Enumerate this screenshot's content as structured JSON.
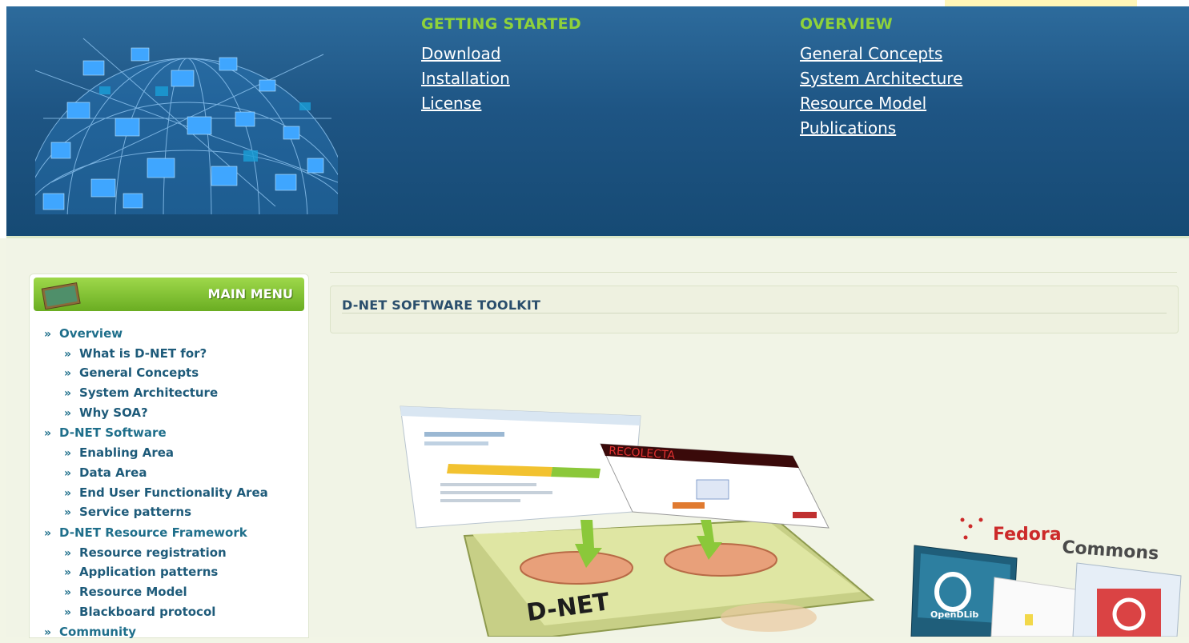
{
  "header": {
    "getting_started": {
      "heading": "GETTING STARTED",
      "links": [
        "Download",
        "Installation",
        "License"
      ]
    },
    "overview": {
      "heading": "OVERVIEW",
      "links": [
        "General Concepts",
        "System Architecture",
        "Resource Model",
        "Publications"
      ]
    }
  },
  "main_menu": {
    "title": "MAIN MENU",
    "items": [
      {
        "label": "Overview",
        "level": 0
      },
      {
        "label": "What is D-NET for?",
        "level": 1
      },
      {
        "label": "General Concepts",
        "level": 1
      },
      {
        "label": "System Architecture",
        "level": 1
      },
      {
        "label": "Why SOA?",
        "level": 1
      },
      {
        "label": "D-NET Software",
        "level": 0
      },
      {
        "label": "Enabling Area",
        "level": 1
      },
      {
        "label": "Data Area",
        "level": 1
      },
      {
        "label": "End User Functionality Area",
        "level": 1
      },
      {
        "label": "Service patterns",
        "level": 1
      },
      {
        "label": "D-NET Resource Framework",
        "level": 0
      },
      {
        "label": "Resource registration",
        "level": 1
      },
      {
        "label": "Application patterns",
        "level": 1
      },
      {
        "label": "Resource Model",
        "level": 1
      },
      {
        "label": "Blackboard protocol",
        "level": 1
      },
      {
        "label": "Community",
        "level": 0
      }
    ],
    "bullet": "»"
  },
  "content": {
    "section_title": "D-NET SOFTWARE TOOLKIT",
    "illustration": {
      "platform_label": "D-NET",
      "screen_label": "RECOLECTA",
      "fedora_label_a": "Fedora",
      "fedora_label_b": "Commons",
      "opendlib_label": "OpenDLib"
    }
  },
  "colors": {
    "header_bg": "#1e5584",
    "nav_heading": "#8fd23a",
    "menu_green": "#7fc236",
    "menu_link": "#1f6f8b",
    "content_bg": "#f1f4e6"
  }
}
